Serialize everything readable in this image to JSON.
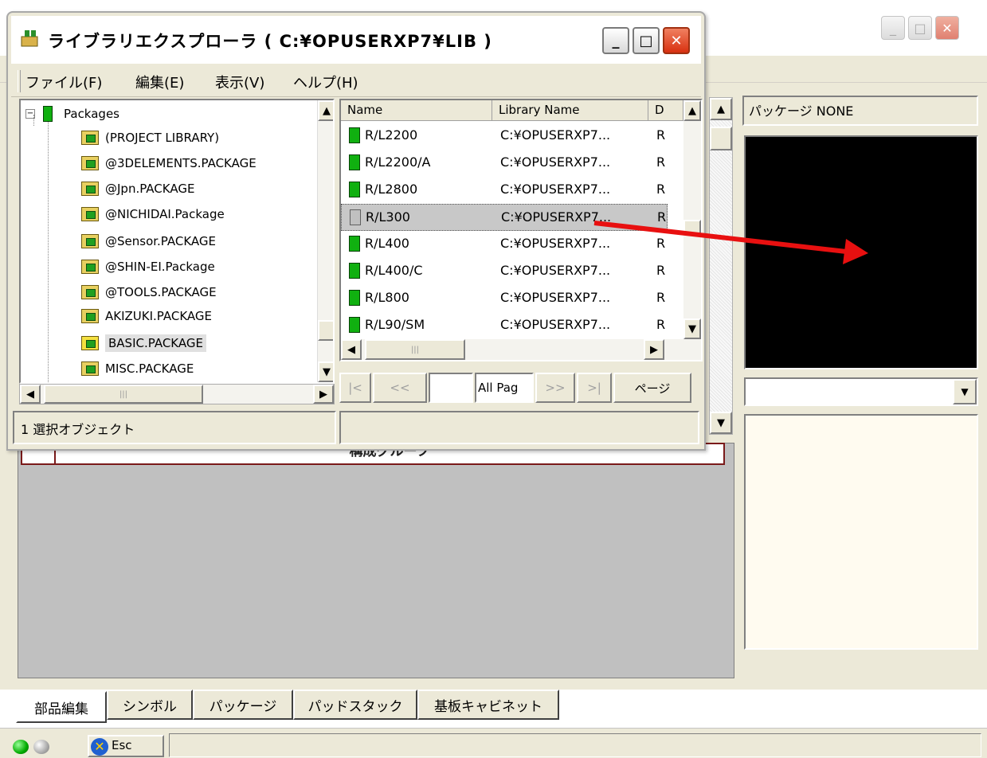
{
  "library_window": {
    "title": "ライブラリエクスプローラ ( C:¥OPUSERXP7¥LIB )",
    "menu": [
      "ファイル(F)",
      "編集(E)",
      "表示(V)",
      "ヘルプ(H)"
    ],
    "tree": {
      "root": "Packages",
      "items": [
        "(PROJECT LIBRARY)",
        "@3DELEMENTS.PACKAGE",
        "@Jpn.PACKAGE",
        "@NICHIDAI.Package",
        "@Sensor.PACKAGE",
        "@SHIN-EI.Package",
        "@TOOLS.PACKAGE",
        "AKIZUKI.PACKAGE",
        "BASIC.PACKAGE",
        "MISC.PACKAGE"
      ],
      "selected": "BASIC.PACKAGE"
    },
    "list": {
      "columns": [
        "Name",
        "Library Name",
        "D"
      ],
      "rows": [
        {
          "name": "R/L2200",
          "library": "C:¥OPUSERXP7...",
          "d": "R"
        },
        {
          "name": "R/L2200/A",
          "library": "C:¥OPUSERXP7...",
          "d": "R"
        },
        {
          "name": "R/L2800",
          "library": "C:¥OPUSERXP7...",
          "d": "R"
        },
        {
          "name": "R/L300",
          "library": "C:¥OPUSERXP7...",
          "d": "R"
        },
        {
          "name": "R/L400",
          "library": "C:¥OPUSERXP7...",
          "d": "R"
        },
        {
          "name": "R/L400/C",
          "library": "C:¥OPUSERXP7...",
          "d": "R"
        },
        {
          "name": "R/L800",
          "library": "C:¥OPUSERXP7...",
          "d": "R"
        },
        {
          "name": "R/L90/SM",
          "library": "C:¥OPUSERXP7...",
          "d": "R"
        }
      ],
      "selected": "R/L300"
    },
    "pager": {
      "first": "|<",
      "prev": "<<",
      "page_value": "",
      "all_pages": "All Pag",
      "next": ">>",
      "last": ">|",
      "page_button": "ページ"
    },
    "status": "1 選択オブジェクト"
  },
  "app": {
    "package_label": "パッケージ NONE",
    "group_header": "構成グループ",
    "tabs": [
      "部品編集",
      "シンボル",
      "パッケージ",
      "パッドスタック",
      "基板キャビネット"
    ],
    "active_tab": "部品編集",
    "esc_label": "Esc"
  },
  "colors": {
    "arrow": "#e81010",
    "chip_green": "#10b010",
    "preview_bg": "#000000",
    "notes_bg": "#fffbf0"
  }
}
